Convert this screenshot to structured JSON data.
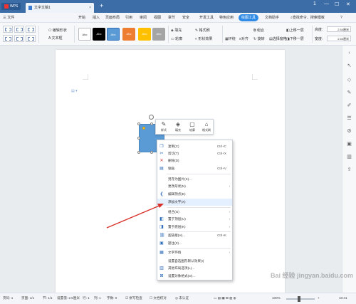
{
  "titlebar": {
    "app_label": "WPS",
    "doc_tab": "文字文稿1",
    "new_tab": "+",
    "controls": [
      "1",
      "—",
      "☐",
      "✕"
    ]
  },
  "menubar": {
    "file": "三 文件",
    "items": [
      "开始",
      "插入",
      "页面布局",
      "引用",
      "审阅",
      "视图",
      "章节",
      "安全",
      "开发工具",
      "特色应用",
      "绘图工具",
      "文档助手"
    ],
    "active_index": 10,
    "search": "查找命令、搜索模板",
    "help": "?"
  },
  "ribbon": {
    "edit_shape": "编辑形状",
    "textbox": "文本框",
    "swatch_text": "Abc",
    "swatch_colors": [
      "#ffffff",
      "#000000",
      "#5b9bd5",
      "#ed7d31",
      "#ffc000",
      "#a5a5a5"
    ],
    "fill": "填充",
    "outline": "轮廓",
    "format_painter": "格式刷",
    "shape_effects": "形状效果",
    "wrap": "环绕",
    "align": "对齐",
    "group": "组合",
    "rotate": "旋转",
    "select_pane": "选择窗格",
    "bring_forward": "上移一层",
    "send_backward": "下移一层",
    "height_label": "高度:",
    "width_label": "宽度:",
    "height_value": "2.54厘米",
    "width_value": "2.54厘米"
  },
  "mini_toolbar": {
    "style": "样式",
    "fill": "填充",
    "outline": "轮廓",
    "format_painter": "格式刷"
  },
  "context_menu": {
    "items": [
      {
        "label": "复制(C)",
        "shortcut": "Ctrl+C",
        "icon": "copy-icon",
        "glyph": "❐"
      },
      {
        "label": "剪切(T)",
        "shortcut": "Ctrl+X",
        "icon": "cut-icon",
        "glyph": "✂"
      },
      {
        "label": "删除(D)",
        "shortcut": "",
        "icon": "delete-icon",
        "glyph": "✕"
      },
      {
        "label": "粘贴",
        "shortcut": "Ctrl+V",
        "icon": "paste-icon",
        "glyph": "▤"
      },
      {
        "label": "另存为图片(S)...",
        "shortcut": "",
        "icon": "",
        "glyph": ""
      },
      {
        "label": "更改形状(N)",
        "shortcut": "",
        "icon": "",
        "glyph": "",
        "submenu": true
      },
      {
        "label": "编辑顶点(E)",
        "shortcut": "",
        "icon": "edit-points-icon",
        "glyph": "❮"
      },
      {
        "label": "添加文字(X)",
        "shortcut": "",
        "icon": "",
        "glyph": ""
      },
      {
        "label": "组合(G)",
        "shortcut": "",
        "icon": "",
        "glyph": "",
        "submenu": true
      },
      {
        "label": "置于顶层(U)",
        "shortcut": "",
        "icon": "bring-front-icon",
        "glyph": "◧",
        "submenu": true
      },
      {
        "label": "置于底层(K)",
        "shortcut": "",
        "icon": "send-back-icon",
        "glyph": "◨",
        "submenu": true
      },
      {
        "label": "超链接(H)...",
        "shortcut": "Ctrl+K",
        "icon": "hyperlink-icon",
        "glyph": "⛓"
      },
      {
        "label": "题注(Z)...",
        "shortcut": "",
        "icon": "caption-icon",
        "glyph": "▣"
      },
      {
        "label": "文字环绕",
        "shortcut": "",
        "icon": "wrap-text-icon",
        "glyph": "▦",
        "submenu": true
      },
      {
        "label": "设置自选图形默认效果(I)",
        "shortcut": "",
        "icon": "",
        "glyph": ""
      },
      {
        "label": "其他布局选项(L)...",
        "shortcut": "",
        "icon": "layout-options-icon",
        "glyph": "▥"
      },
      {
        "label": "设置对象格式(O)...",
        "shortcut": "",
        "icon": "format-object-icon",
        "glyph": "⊠"
      }
    ]
  },
  "statusbar": {
    "page_num": "页码: 1",
    "pages": "页面: 1/1",
    "section": "节: 1/1",
    "setting": "设置值: 2.5厘米",
    "row": "行: 1",
    "col": "列: 1",
    "words": "字数: 0",
    "spellcheck": "拼写检查",
    "doc_check": "文档校对",
    "cert": "未认证",
    "zoom": "100%",
    "time": "10:41"
  },
  "watermark": "Bai 经验 jingyan.baidu.com"
}
